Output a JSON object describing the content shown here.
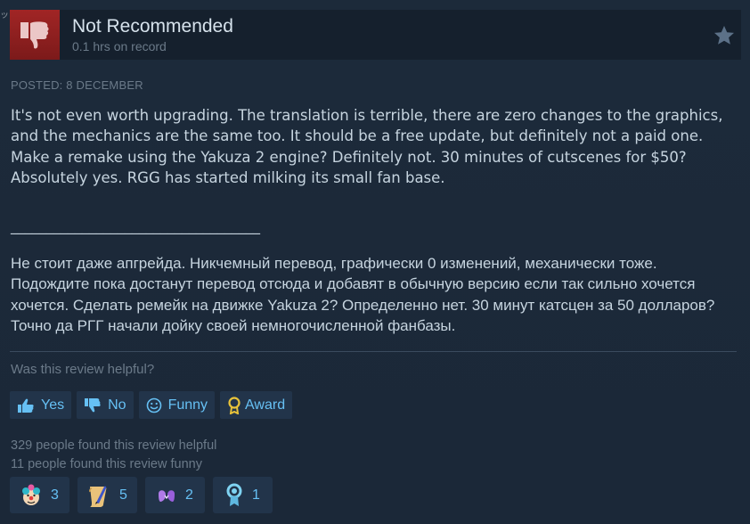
{
  "review": {
    "verdict": "Not Recommended",
    "hours": "0.1 hrs on record",
    "posted": "Posted: 8 December",
    "corner_text": "ッ",
    "body_en": "It's not even worth upgrading. The translation is terrible, there are zero changes to the graphics, and the mechanics are the same too. It should be a free update, but definitely not a paid one. Make a remake using the Yakuza 2 engine? Definitely not. 30 minutes of cutscenes for $50? Absolutely yes. RGG has started milking its small fan base.",
    "divider": "___________________________________",
    "body_ru": "Не стоит даже апгрейда. Никчемный перевод, графически 0 изменений, механически тоже. Подождите пока достанут перевод отсюда и добавят в обычную версию если так сильно хочется хочется. Сделать ремейк на движке Yakuza 2? Определенно нет. 30 минут катсцен за 50 долларов? Точно да РГГ начали дойку своей немногочисленной фанбазы."
  },
  "feedback": {
    "question": "Was this review helpful?",
    "yes_label": "Yes",
    "no_label": "No",
    "funny_label": "Funny",
    "award_label": "Award"
  },
  "stats": {
    "helpful": "329 people found this review helpful",
    "funny": "11 people found this review funny"
  },
  "awards": [
    {
      "icon": "clown-face-icon",
      "count": "3"
    },
    {
      "icon": "scroll-quill-icon",
      "count": "5"
    },
    {
      "icon": "heart-hands-icon",
      "count": "2"
    },
    {
      "icon": "ribbon-medal-icon",
      "count": "1"
    }
  ],
  "colors": {
    "background": "#1b2838",
    "thumbs_down_bg": "#a12525",
    "link_blue": "#66c0f4",
    "muted_text": "#6b7a89",
    "button_bg": "#22344a"
  }
}
